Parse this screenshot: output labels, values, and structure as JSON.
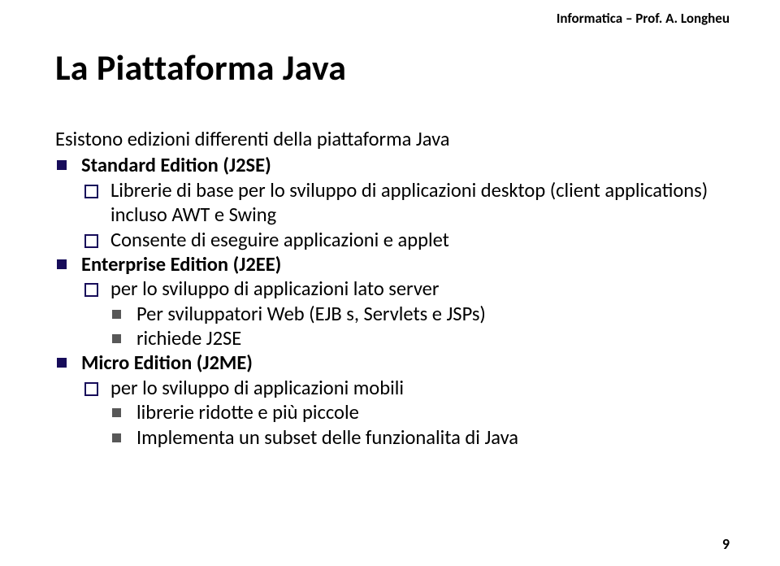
{
  "header": {
    "text": "Informatica – Prof. A. Longheu"
  },
  "title": "La Piattaforma Java",
  "intro": "Esistono edizioni differenti della piattaforma Java",
  "editions": [
    {
      "name": "Standard Edition (J2SE)",
      "subitems": [
        {
          "text": "Librerie di base per lo sviluppo di applicazioni desktop (client applications) incluso AWT e  Swing"
        },
        {
          "text": "Consente di eseguire applicazioni e applet"
        }
      ]
    },
    {
      "name": "Enterprise Edition (J2EE)",
      "subitems": [
        {
          "text": "per lo sviluppo di applicazioni lato server",
          "subsub": [
            "Per sviluppatori Web (EJB s, Servlets e JSPs)",
            "richiede J2SE"
          ]
        }
      ]
    },
    {
      "name": "Micro Edition (J2ME)",
      "subitems": [
        {
          "text": "per lo sviluppo di applicazioni mobili",
          "subsub": [
            "librerie ridotte e più piccole",
            "Implementa un subset delle funzionalita di Java"
          ]
        }
      ]
    }
  ],
  "page_number": "9"
}
